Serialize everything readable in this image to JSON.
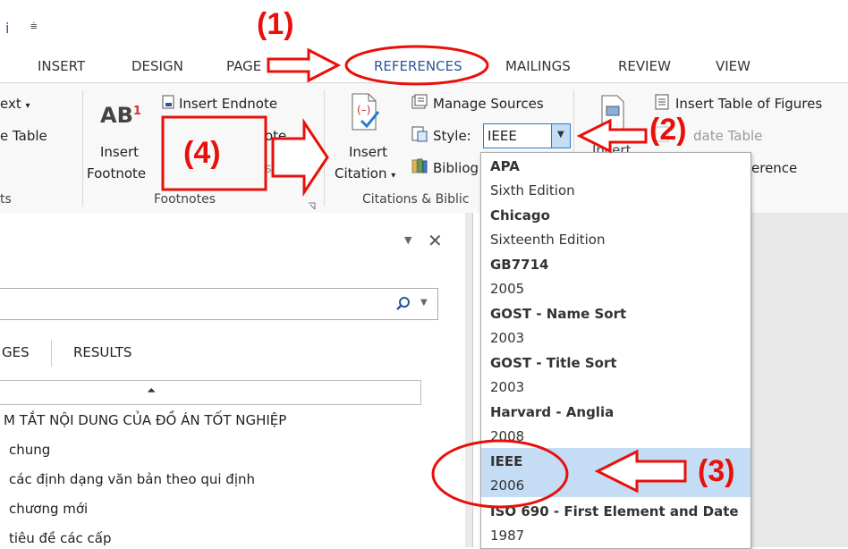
{
  "qat": {
    "initial": "i",
    "dropdown_glyph": "⩧"
  },
  "tabs": [
    {
      "label": "INSERT"
    },
    {
      "label": "DESIGN"
    },
    {
      "label": "PAGE"
    },
    {
      "label": "REFERENCES"
    },
    {
      "label": "MAILINGS"
    },
    {
      "label": "REVIEW"
    },
    {
      "label": "VIEW"
    }
  ],
  "ribbon": {
    "toc": {
      "add_text": "ext",
      "update_table": "e Table",
      "group_label": "ts"
    },
    "footnotes": {
      "insert_endnote": "Insert Endnote",
      "ab": "AB",
      "sup": "1",
      "insert_footnote_l1": "Insert",
      "insert_footnote_l2": "Footnote",
      "next_partial": "ote",
      "show_partial": "s",
      "group_label": "Footnotes"
    },
    "citations": {
      "insert_citation_l1": "Insert",
      "insert_citation_l2": "Citation",
      "manage_sources": "Manage Sources",
      "style_label": "Style:",
      "style_value": "IEEE",
      "bibliography_partial": "Bibliog",
      "group_label": "Citations & Biblic"
    },
    "captions": {
      "insert_table_of_figures": "Insert Table of Figures",
      "update_table_partial": "date Table",
      "insert_partial": "Incert",
      "cross_ref_partial": "erence"
    }
  },
  "style_options": [
    {
      "name": "APA",
      "version": "Sixth Edition"
    },
    {
      "name": "Chicago",
      "version": "Sixteenth Edition"
    },
    {
      "name": "GB7714",
      "version": "2005"
    },
    {
      "name": "GOST - Name Sort",
      "version": "2003"
    },
    {
      "name": "GOST - Title Sort",
      "version": "2003"
    },
    {
      "name": "Harvard - Anglia",
      "version": "2008"
    },
    {
      "name": "IEEE",
      "version": "2006"
    },
    {
      "name": "ISO 690 - First Element and Date",
      "version": "1987"
    }
  ],
  "selected_style": "IEEE",
  "navigation": {
    "tab_pages_partial": "GES",
    "tab_results": "RESULTS",
    "headings": [
      "M TẮT NỘI DUNG CỦA ĐỒ ÁN TỐT NGHIỆP",
      "chung",
      "các định dạng văn bản theo qui định",
      "chương mới",
      "tiêu đề các cấp"
    ]
  },
  "annotations": {
    "a1": "(1)",
    "a2": "(2)",
    "a3": "(3)",
    "a4": "(4)"
  },
  "colors": {
    "annotation_red": "#e8100a",
    "selected_item": "#c5dcf5",
    "references_tab": "#2b579a"
  }
}
